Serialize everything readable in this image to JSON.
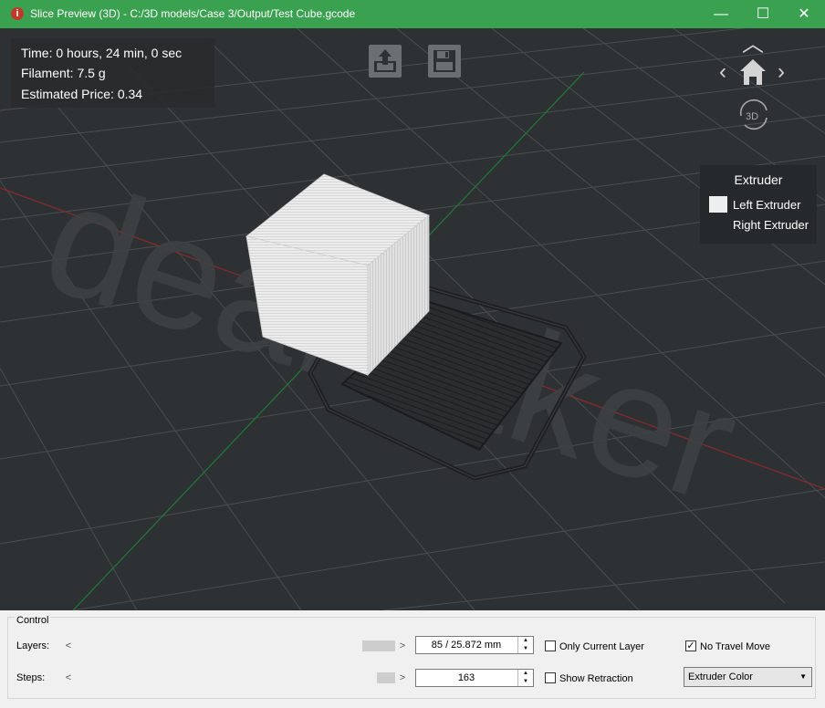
{
  "window": {
    "title": "Slice Preview (3D) - C:/3D models/Case 3/Output/Test Cube.gcode",
    "minimize_glyph": "—",
    "maximize_glyph": "☐",
    "close_glyph": "✕",
    "app_icon_glyph": "i"
  },
  "info": {
    "time": "Time: 0 hours, 24 min, 0 sec",
    "filament": "Filament: 7.5 g",
    "price": "Estimated Price: 0.34"
  },
  "toolbar": {
    "upload_icon": "upload-icon",
    "save_icon": "save-icon"
  },
  "navigation": {
    "view_mode_label": "3D",
    "up_glyph": "︿",
    "left_glyph": "‹",
    "right_glyph": "›"
  },
  "watermark": "deamaker",
  "legend": {
    "title": "Extruder",
    "items": [
      {
        "label": "Left Extruder",
        "color": "#eeeeee"
      },
      {
        "label": "Right Extruder",
        "color": "#26292b"
      }
    ]
  },
  "control": {
    "group_title": "Control",
    "layers": {
      "label": "Layers:",
      "value": "85 / 25.872 mm",
      "position": 0.91
    },
    "steps": {
      "label": "Steps:",
      "value": "163",
      "position": 0.96
    },
    "left_arrow": "<",
    "right_arrow": ">",
    "spin_up": "▲",
    "spin_down": "▼",
    "only_current_layer": {
      "label": "Only Current Layer",
      "checked": false
    },
    "show_retraction": {
      "label": "Show Retraction",
      "checked": false
    },
    "no_travel_move": {
      "label": "No Travel Move",
      "checked": true
    },
    "check_glyph": "✓",
    "color_mode": {
      "selected": "Extruder Color",
      "arrow": "▼"
    }
  },
  "colors": {
    "titlebar": "#3aa150",
    "viewport_bg": "#2e3133",
    "grid": "#4a4e51",
    "x_axis": "#8b2a2a",
    "y_axis": "#1f7a35",
    "cube": "#e6e6e6",
    "support": "#222426"
  }
}
